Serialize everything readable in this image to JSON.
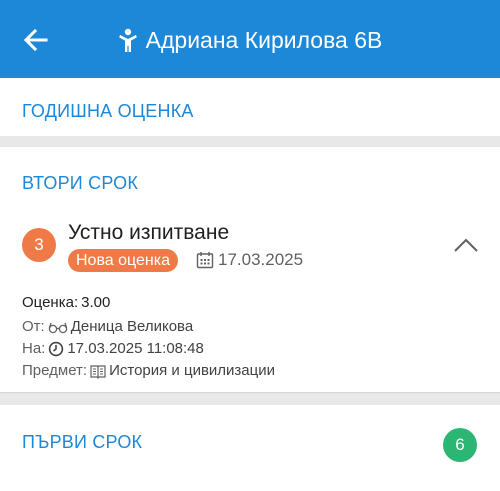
{
  "header": {
    "title": "Адриана Кирилова 6В",
    "back_icon": "arrow-left-icon",
    "child_icon": "child-icon",
    "color": "#1e88d8"
  },
  "sections": {
    "annual": {
      "label": "ГОДИШНА ОЦЕНКА"
    },
    "second_term": {
      "label": "ВТОРИ СРОК"
    },
    "first_term": {
      "label": "ПЪРВИ СРОК",
      "count": "6"
    }
  },
  "grade_item": {
    "value": "3",
    "title": "Устно изпитване",
    "badge": "Нова оценка",
    "date": "17.03.2025",
    "details": {
      "grade_label": "Оценка:",
      "grade_value": "3.00",
      "from_label": "От:",
      "teacher": "Деница Великова",
      "at_label": "На:",
      "timestamp": "17.03.2025 11:08:48",
      "subject_label": "Предмет:",
      "subject": "История и цивилизации"
    }
  },
  "colors": {
    "accent": "#1e88d8",
    "grade_orange": "#f07a47",
    "count_green": "#2bb673"
  }
}
